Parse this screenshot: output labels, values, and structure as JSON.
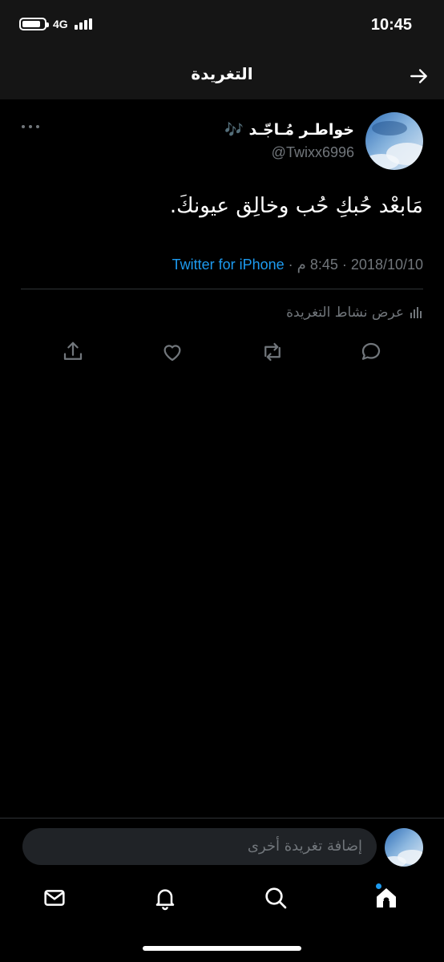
{
  "status_bar": {
    "network": "4G",
    "time": "10:45",
    "battery_level": 0.85
  },
  "nav": {
    "title": "التغريدة",
    "back_icon": "arrow-right-icon"
  },
  "tweet": {
    "author_name": "خواطـر مُـاجّـد 🎶",
    "author_handle": "@Twixx6996",
    "text": "مَابعْد حُبكِ حُب وخالِق عيونكَ.",
    "time": "8:45 م",
    "date": "2018/10/10",
    "separator": "·",
    "source": "Twitter for iPhone",
    "activity_label": "عرض نشاط التغريدة",
    "icons": {
      "more": "more-dots-icon",
      "reply": "reply-icon",
      "retweet": "retweet-icon",
      "like": "heart-icon",
      "share": "share-icon"
    }
  },
  "composer": {
    "placeholder": "إضافة تغريدة أخرى"
  },
  "tab_bar": {
    "items": [
      "home-icon",
      "search-icon",
      "notifications-icon",
      "messages-icon"
    ],
    "active": "home"
  },
  "colors": {
    "background": "#000000",
    "accent": "#1d9bf0",
    "secondary_text": "#71767b",
    "bar": "#151515"
  }
}
